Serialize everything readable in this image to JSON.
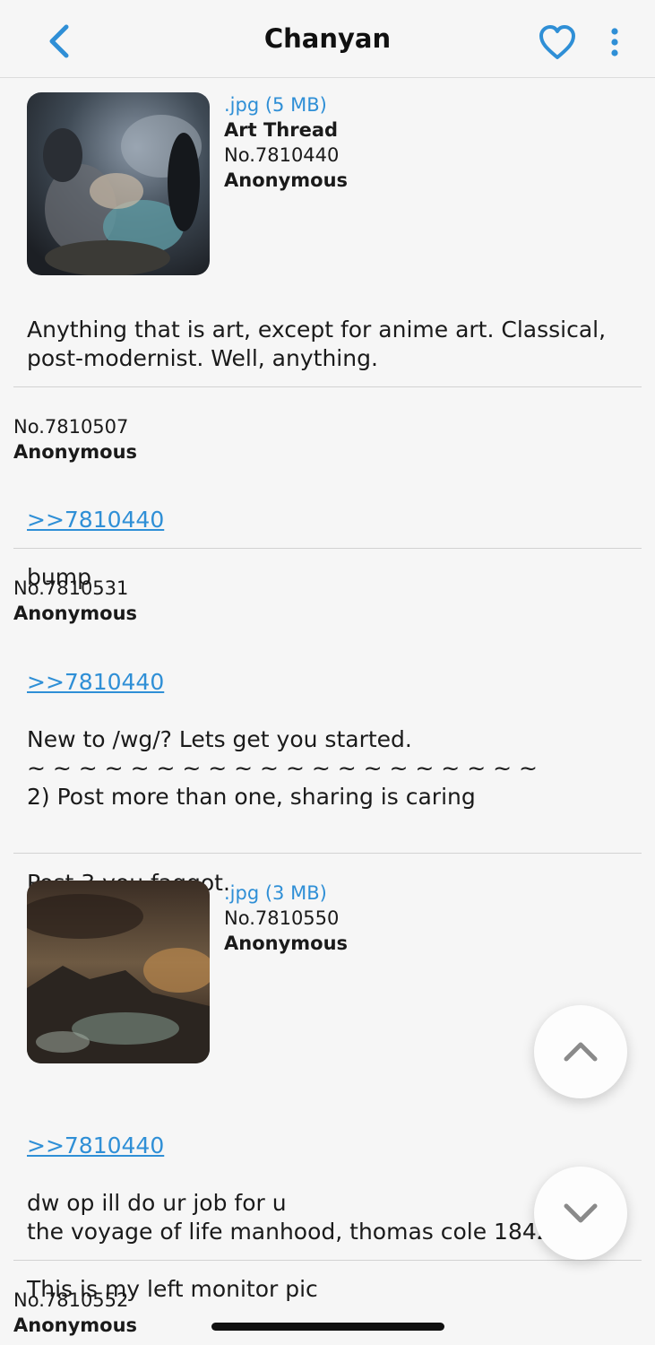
{
  "header": {
    "title": "Chanyan",
    "back_icon": "chevron-left-icon",
    "favorite_icon": "heart-icon",
    "menu_icon": "more-vertical-icon",
    "accent_color": "#2f8fd6"
  },
  "posts": [
    {
      "file": ".jpg (5 MB)",
      "subject": "Art Thread",
      "number": "No.7810440",
      "name": "Anonymous",
      "body": "Anything that is art, except for anime art. Classical,\npost-modernist. Well, anything."
    },
    {
      "number": "No.7810507",
      "name": "Anonymous",
      "quote": ">>7810440",
      "body": "bump"
    },
    {
      "number": "No.7810531",
      "name": "Anonymous",
      "quote": ">>7810440",
      "body": "New to /wg/? Lets get you started.\n~ ~ ~ ~ ~ ~ ~ ~ ~ ~ ~ ~ ~ ~ ~ ~ ~ ~ ~ ~\n2) Post more than one, sharing is caring\n\n\nPost 3 you faggot."
    },
    {
      "file": ".jpg (3 MB)",
      "number": "No.7810550",
      "name": "Anonymous",
      "quote": ">>7810440",
      "body": "dw op ill do ur job for u\nthe voyage of life manhood, thomas cole 1842\n\nThis is my left monitor pic"
    },
    {
      "number": "No.7810552",
      "name": "Anonymous"
    }
  ],
  "scroll_buttons": {
    "up_icon": "chevron-up-icon",
    "down_icon": "chevron-down-icon"
  }
}
